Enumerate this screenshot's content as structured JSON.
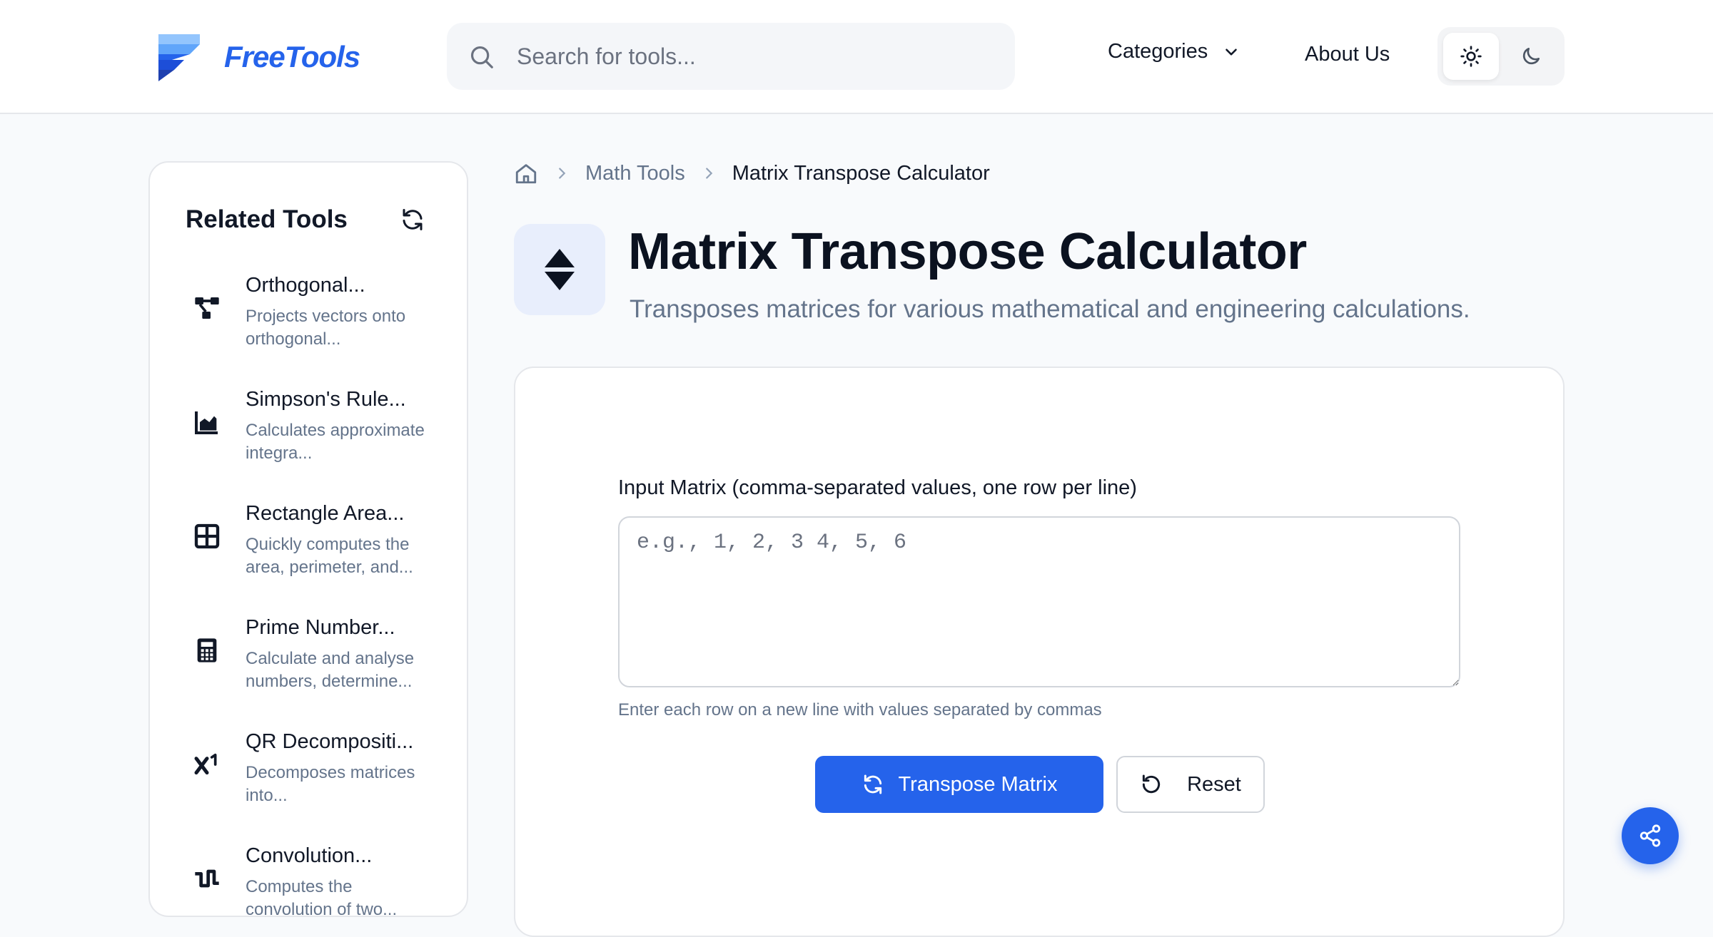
{
  "brand": {
    "name": "FreeTools",
    "color": "#2563eb"
  },
  "search": {
    "placeholder": "Search for tools..."
  },
  "nav": {
    "categories": "Categories",
    "about": "About Us"
  },
  "theme": {
    "active": "light"
  },
  "sidebar": {
    "title": "Related Tools",
    "items": [
      {
        "name": "Orthogonal...",
        "desc": "Projects vectors onto orthogonal...",
        "icon": "vector-graph-icon"
      },
      {
        "name": "Simpson's Rule...",
        "desc": "Calculates approximate integra...",
        "icon": "area-chart-icon"
      },
      {
        "name": "Rectangle Area...",
        "desc": "Quickly computes the area, perimeter, and...",
        "icon": "grid-table-icon"
      },
      {
        "name": "Prime Number...",
        "desc": "Calculate and analyse numbers, determine...",
        "icon": "calculator-icon"
      },
      {
        "name": "QR Decompositi...",
        "desc": "Decomposes matrices into...",
        "icon": "superscript-icon"
      },
      {
        "name": "Convolution...",
        "desc": "Computes the convolution of two...",
        "icon": "waveform-icon"
      }
    ]
  },
  "breadcrumb": {
    "parent": "Math Tools",
    "current": "Matrix Transpose Calculator"
  },
  "page": {
    "title": "Matrix Transpose Calculator",
    "subtitle": "Transposes matrices for various mathematical and engineering calculations.",
    "icon": "sort-arrows-icon"
  },
  "form": {
    "label": "Input Matrix (comma-separated values, one row per line)",
    "placeholder": "e.g., 1, 2, 3 4, 5, 6",
    "value": "",
    "help": "Enter each row on a new line with values separated by commas",
    "submit_label": "Transpose Matrix",
    "reset_label": "Reset"
  }
}
